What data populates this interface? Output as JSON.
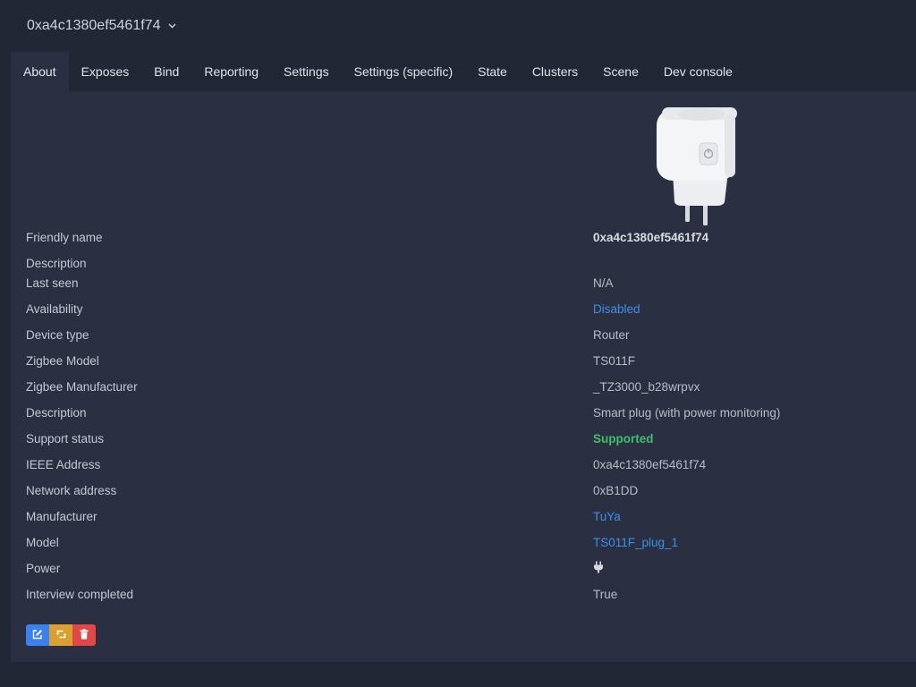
{
  "device": {
    "friendly_name": "0xa4c1380ef5461f74"
  },
  "tabs": [
    {
      "label": "About",
      "active": true
    },
    {
      "label": "Exposes"
    },
    {
      "label": "Bind"
    },
    {
      "label": "Reporting"
    },
    {
      "label": "Settings"
    },
    {
      "label": "Settings (specific)"
    },
    {
      "label": "State"
    },
    {
      "label": "Clusters"
    },
    {
      "label": "Scene"
    },
    {
      "label": "Dev console"
    }
  ],
  "properties": {
    "friendly_name": {
      "label": "Friendly name",
      "value": "0xa4c1380ef5461f74"
    },
    "description_top": {
      "label": "Description",
      "value": ""
    },
    "last_seen": {
      "label": "Last seen",
      "value": "N/A"
    },
    "availability": {
      "label": "Availability",
      "value": "Disabled"
    },
    "device_type": {
      "label": "Device type",
      "value": "Router"
    },
    "zigbee_model": {
      "label": "Zigbee Model",
      "value": "TS011F"
    },
    "zigbee_manufacturer": {
      "label": "Zigbee Manufacturer",
      "value": "_TZ3000_b28wrpvx"
    },
    "description": {
      "label": "Description",
      "value": "Smart plug (with power monitoring)"
    },
    "support_status": {
      "label": "Support status",
      "value": "Supported"
    },
    "ieee_address": {
      "label": "IEEE Address",
      "value": "0xa4c1380ef5461f74"
    },
    "network_address": {
      "label": "Network address",
      "value": "0xB1DD"
    },
    "manufacturer": {
      "label": "Manufacturer",
      "value": "TuYa"
    },
    "model": {
      "label": "Model",
      "value": "TS011F_plug_1"
    },
    "power": {
      "label": "Power",
      "icon": "plug-icon"
    },
    "interview_completed": {
      "label": "Interview completed",
      "value": "True"
    }
  },
  "actions": {
    "edit_icon": "edit-icon",
    "reconfigure_icon": "retweet-icon",
    "remove_icon": "trash-icon"
  },
  "colors": {
    "link": "#3f8ee8",
    "success": "#3fbf6a",
    "edit": "#3b82f0",
    "reconfigure": "#d9a030",
    "remove": "#e04848"
  }
}
